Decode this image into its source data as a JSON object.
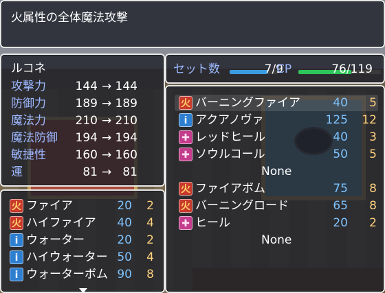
{
  "help": {
    "text": "火属性の全体魔法攻撃"
  },
  "status": {
    "actor_name": "ルコネ",
    "arrow": "→",
    "params": [
      {
        "label": "攻撃力",
        "before": "144",
        "after": "144"
      },
      {
        "label": "防御力",
        "before": "189",
        "after": "189"
      },
      {
        "label": "魔法力",
        "before": "210",
        "after": "210"
      },
      {
        "label": "魔法防御",
        "before": "194",
        "after": "194"
      },
      {
        "label": "敏捷性",
        "before": "160",
        "after": "160"
      },
      {
        "label": "運",
        "before": "81",
        "after": "81"
      }
    ]
  },
  "capacity": {
    "set_label": "セット数",
    "set_value": "7/9",
    "set_ratio": 0.78,
    "cp_label": "CP",
    "cp_value": "76/119",
    "cp_ratio": 0.64,
    "set_color": "#3c9be0",
    "cp_color": "#2fc45a"
  },
  "equipped": {
    "items": [
      {
        "icon": "fire-icon",
        "type": "fire",
        "glyph": "火",
        "name": "バーニングファイア",
        "mp": "40",
        "tp": "5"
      },
      {
        "icon": "water-icon",
        "type": "water",
        "glyph": "i",
        "name": "アクアノヴァ",
        "mp": "125",
        "tp": "12"
      },
      {
        "icon": "heal-icon",
        "type": "heal",
        "glyph": "✚",
        "name": "レッドヒール",
        "mp": "40",
        "tp": "3"
      },
      {
        "icon": "heal-icon",
        "type": "heal",
        "glyph": "✚",
        "name": "ソウルコール",
        "mp": "50",
        "tp": "5"
      },
      {
        "none": "None"
      },
      {
        "icon": "fire-icon",
        "type": "fire",
        "glyph": "火",
        "name": "ファイアボム",
        "mp": "75",
        "tp": "8"
      },
      {
        "icon": "fire-icon",
        "type": "fire",
        "glyph": "火",
        "name": "バーニングロード",
        "mp": "65",
        "tp": "8"
      },
      {
        "icon": "heal-icon",
        "type": "heal",
        "glyph": "✚",
        "name": "ヒール",
        "mp": "20",
        "tp": "2"
      },
      {
        "none": "None"
      }
    ]
  },
  "skill_list": {
    "items": [
      {
        "icon": "fire-icon",
        "type": "fire",
        "glyph": "火",
        "name": "ファイア",
        "mp": "20",
        "tp": "2"
      },
      {
        "icon": "fire-icon",
        "type": "fire",
        "glyph": "火",
        "name": "ハイファイア",
        "mp": "40",
        "tp": "4"
      },
      {
        "icon": "water-icon",
        "type": "water",
        "glyph": "i",
        "name": "ウォーター",
        "mp": "20",
        "tp": "2"
      },
      {
        "icon": "water-icon",
        "type": "water",
        "glyph": "i",
        "name": "ハイウォーター",
        "mp": "50",
        "tp": "4"
      },
      {
        "icon": "water-icon",
        "type": "water",
        "glyph": "i",
        "name": "ウォーターボム",
        "mp": "90",
        "tp": "8"
      }
    ]
  }
}
